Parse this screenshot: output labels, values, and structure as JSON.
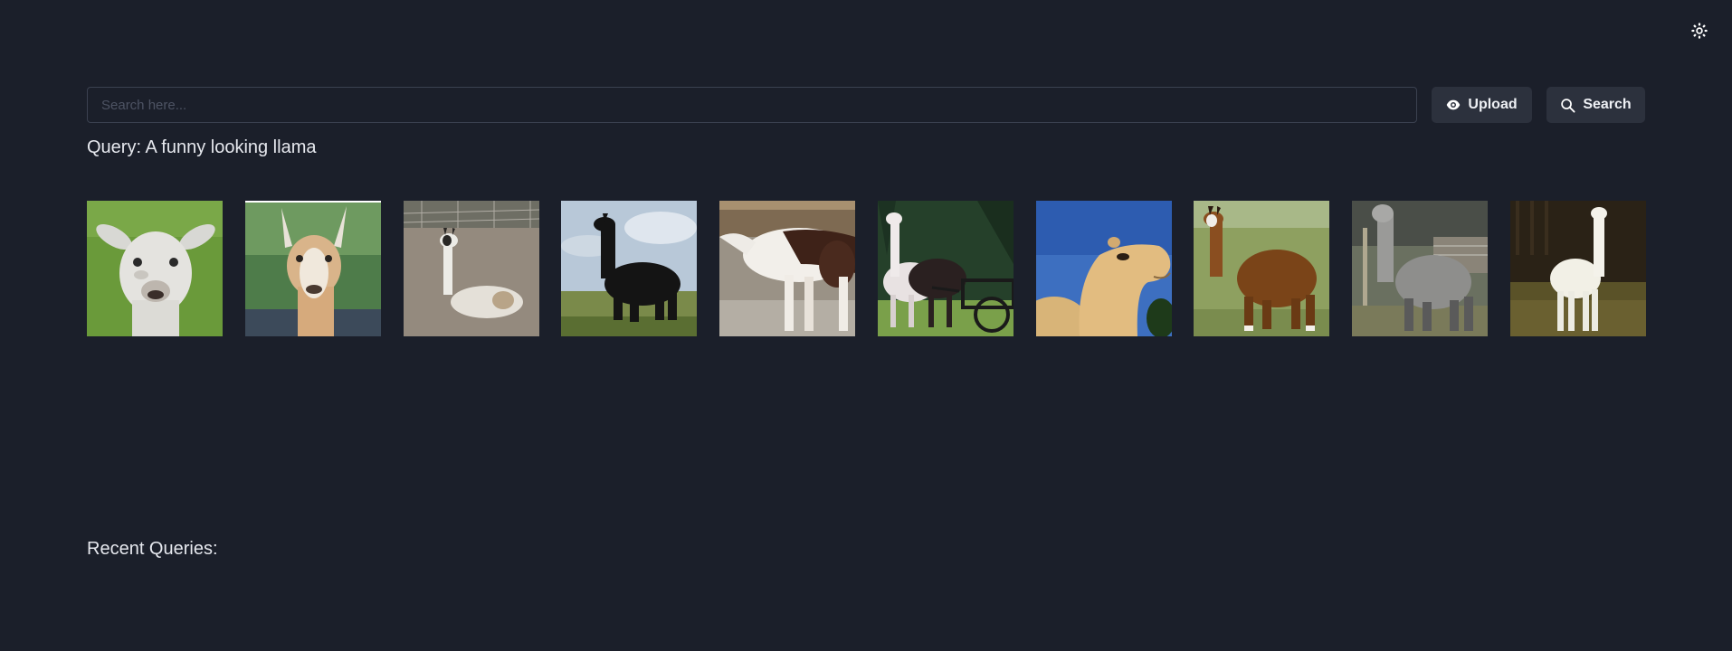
{
  "header": {
    "theme_toggle_icon": "sun-icon"
  },
  "search": {
    "placeholder": "Search here...",
    "value": "",
    "upload_label": "Upload",
    "upload_icon": "eye-icon",
    "search_label": "Search",
    "search_icon": "search-icon"
  },
  "query": {
    "text": "Query: A funny looking llama"
  },
  "results": {
    "images": [
      {
        "subject": "white llama face on green grass"
      },
      {
        "subject": "tan and white llama portrait"
      },
      {
        "subject": "white llama lying on dirt"
      },
      {
        "subject": "black alpaca against sky"
      },
      {
        "subject": "brown and white llama standing"
      },
      {
        "subject": "llamas pulling a cart"
      },
      {
        "subject": "camel face against blue sky"
      },
      {
        "subject": "brown llama on grass"
      },
      {
        "subject": "grey shaggy llama"
      },
      {
        "subject": "white llama in barn"
      }
    ]
  },
  "recent": {
    "title": "Recent Queries:"
  },
  "colors": {
    "background": "#1b1f2a",
    "button": "#2c313d",
    "border": "#3b4150",
    "text": "#e6e8ee"
  }
}
